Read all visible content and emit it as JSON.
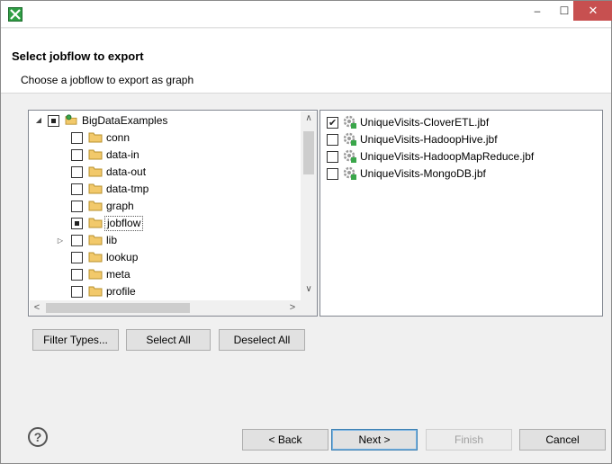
{
  "window": {
    "title": "",
    "controls": {
      "minimize": "–",
      "maximize": "☐",
      "close": "✕"
    }
  },
  "header": {
    "title": "Select jobflow to export",
    "description": "Choose a jobflow to export as graph"
  },
  "tree": {
    "root": {
      "label": "BigDataExamples",
      "expander": "◢",
      "state": "partial"
    },
    "items": [
      {
        "label": "conn",
        "state": "unchecked",
        "has_children": false
      },
      {
        "label": "data-in",
        "state": "unchecked",
        "has_children": false
      },
      {
        "label": "data-out",
        "state": "unchecked",
        "has_children": false
      },
      {
        "label": "data-tmp",
        "state": "unchecked",
        "has_children": false
      },
      {
        "label": "graph",
        "state": "unchecked",
        "has_children": false
      },
      {
        "label": "jobflow",
        "state": "partial",
        "has_children": false,
        "selected": true
      },
      {
        "label": "lib",
        "state": "unchecked",
        "has_children": true,
        "expander": "▷"
      },
      {
        "label": "lookup",
        "state": "unchecked",
        "has_children": false
      },
      {
        "label": "meta",
        "state": "unchecked",
        "has_children": false
      },
      {
        "label": "profile",
        "state": "unchecked",
        "has_children": false
      }
    ],
    "scroll": {
      "up": "∧",
      "down": "∨",
      "left": "<",
      "right": ">"
    }
  },
  "files": [
    {
      "label": "UniqueVisits-CloverETL.jbf",
      "checked": true
    },
    {
      "label": "UniqueVisits-HadoopHive.jbf",
      "checked": false
    },
    {
      "label": "UniqueVisits-HadoopMapReduce.jbf",
      "checked": false
    },
    {
      "label": "UniqueVisits-MongoDB.jbf",
      "checked": false
    }
  ],
  "selection_buttons": {
    "filter_types": "Filter Types...",
    "select_all": "Select All",
    "deselect_all": "Deselect All"
  },
  "footer": {
    "help": "?",
    "back": "< Back",
    "next": "Next >",
    "finish": "Finish",
    "cancel": "Cancel"
  },
  "colors": {
    "folder": "#f2c96b",
    "close_button": "#c75050",
    "default_button_border": "#3c7fb1",
    "gear": "#9a9a9a",
    "gear_badge": "#3aa64a"
  },
  "icons": {
    "app": "app-logo-icon",
    "folder": "folder-icon",
    "project": "project-icon",
    "jobflow_file": "jobflow-file-icon",
    "help": "help-icon"
  }
}
